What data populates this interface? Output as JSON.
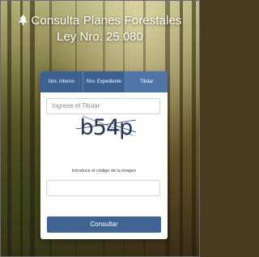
{
  "header": {
    "title_line1": "Consulta Planes Forestales",
    "title_line2": "Ley Nro. 25.080"
  },
  "tabs": [
    {
      "label": "Nro. Interno",
      "active": false
    },
    {
      "label": "Nro. Expediente",
      "active": false
    },
    {
      "label": "Titular",
      "active": true
    }
  ],
  "form": {
    "titular_placeholder": "Ingrese el Titular",
    "captcha_text": "b54p",
    "captcha_label": "Introduce el código de la imagen",
    "captcha_input_value": "",
    "submit_label": "Consultar"
  },
  "colors": {
    "accent": "#3f6493",
    "tab_active": "#4f75a6"
  },
  "icons": {
    "header_icon": "tree-icon"
  }
}
